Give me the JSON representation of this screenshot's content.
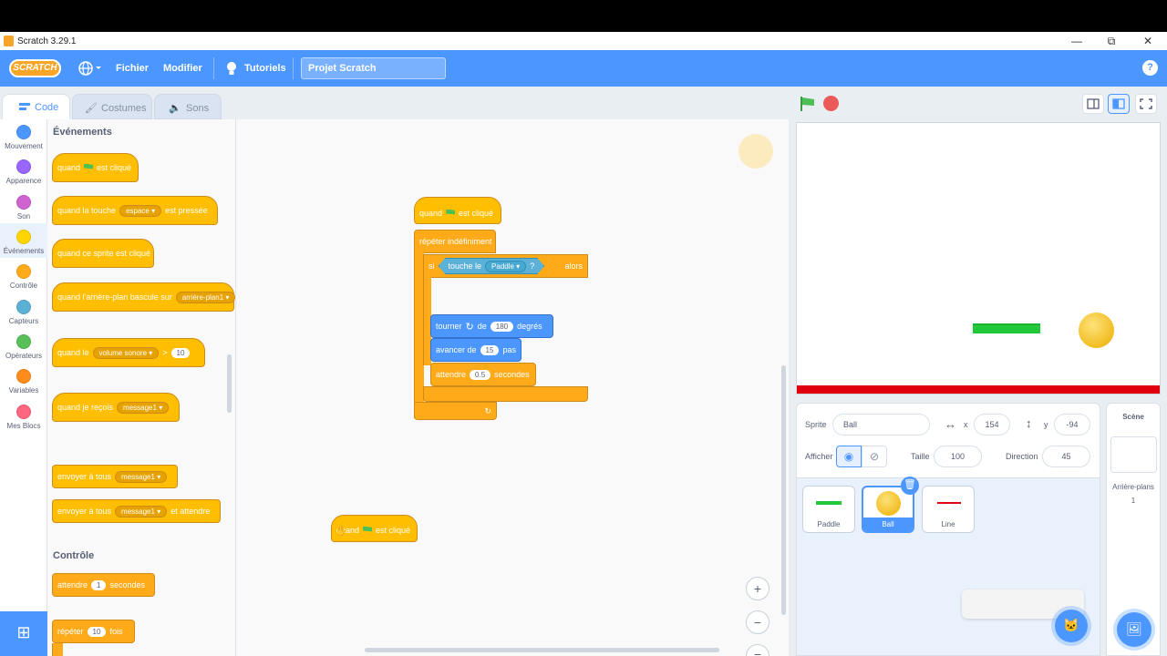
{
  "window": {
    "title": "Scratch 3.29.1",
    "minimize": "—",
    "maximize": "⧉",
    "close": "✕"
  },
  "menubar": {
    "logo": "SCRATCH",
    "file": "Fichier",
    "edit": "Modifier",
    "tutorials": "Tutoriels",
    "project_title": "Projet Scratch",
    "help": "?"
  },
  "tabs": [
    {
      "label": "Code",
      "active": true
    },
    {
      "label": "Costumes",
      "active": false
    },
    {
      "label": "Sons",
      "active": false
    }
  ],
  "categories": [
    {
      "label": "Mouvement",
      "color": "#4c97ff"
    },
    {
      "label": "Apparence",
      "color": "#9966ff"
    },
    {
      "label": "Son",
      "color": "#cf63cf"
    },
    {
      "label": "Événements",
      "color": "#ffd500"
    },
    {
      "label": "Contrôle",
      "color": "#ffab19"
    },
    {
      "label": "Capteurs",
      "color": "#5cb1d6"
    },
    {
      "label": "Opérateurs",
      "color": "#59c059"
    },
    {
      "label": "Variables",
      "color": "#ff8c1a"
    },
    {
      "label": "Mes Blocs",
      "color": "#ff6680"
    }
  ],
  "palette": {
    "events_heading": "Événements",
    "control_heading": "Contrôle",
    "b_when_flag_1": "quand",
    "b_when_flag_2": "est cliqué",
    "b_key_1": "quand la touche",
    "b_key_dd": "espace",
    "b_key_2": "est pressée",
    "b_sprite_clicked": "quand ce sprite est cliqué",
    "b_backdrop_1": "quand l'arrière-plan bascule sur",
    "b_backdrop_dd": "arrière-plan1",
    "b_gt_1": "quand le",
    "b_gt_dd": "volume sonore",
    "b_gt_op": ">",
    "b_gt_val": "10",
    "b_receive_1": "quand je reçois",
    "b_receive_dd": "message1",
    "b_broadcast_1": "envoyer à tous",
    "b_broadcast_dd": "message1",
    "b_broadcastwait_1": "envoyer à tous",
    "b_broadcastwait_dd": "message1",
    "b_broadcastwait_2": "et attendre",
    "b_wait_1": "attendre",
    "b_wait_val": "1",
    "b_wait_2": "secondes",
    "b_repeat_1": "répéter",
    "b_repeat_val": "10",
    "b_repeat_2": "fois"
  },
  "script": {
    "hat_1": "quand",
    "hat_2": "est cliqué",
    "forever": "répéter indéfiniment",
    "if": "si",
    "then": "alors",
    "touching_1": "touche le",
    "touching_dd": "Paddle",
    "touching_q": "?",
    "turn_1": "tourner",
    "turn_2": "de",
    "turn_val": "180",
    "turn_3": "degrés",
    "move_1": "avancer de",
    "move_val": "15",
    "move_2": "pas",
    "wait_1": "attendre",
    "wait_val": "0.5",
    "wait_2": "secondes",
    "loop_arrow": "↻"
  },
  "loose_block": {
    "label_1": "quand",
    "label_2": "est cliqué"
  },
  "zoom": {
    "in": "+",
    "out": "−",
    "reset": "="
  },
  "sprite_info": {
    "sprite_label": "Sprite",
    "sprite_name": "Ball",
    "x_label": "x",
    "x_value": "154",
    "y_label": "y",
    "y_value": "-94",
    "show_label": "Afficher",
    "size_label": "Taille",
    "size_value": "100",
    "direction_label": "Direction",
    "direction_value": "45"
  },
  "sprites": [
    {
      "name": "Paddle",
      "selected": false
    },
    {
      "name": "Ball",
      "selected": true
    },
    {
      "name": "Line",
      "selected": false
    }
  ],
  "scene": {
    "title": "Scène",
    "backdrops_label": "Arrière-plans",
    "backdrops_count": "1"
  },
  "colors": {
    "accent": "#4c97ff",
    "events": "#ffbf00",
    "control": "#ffab19",
    "motion": "#4c97ff",
    "sensing": "#5cb1d6",
    "paddle": "#21c83b",
    "line": "#e0000d",
    "ball": "#f5c731"
  }
}
